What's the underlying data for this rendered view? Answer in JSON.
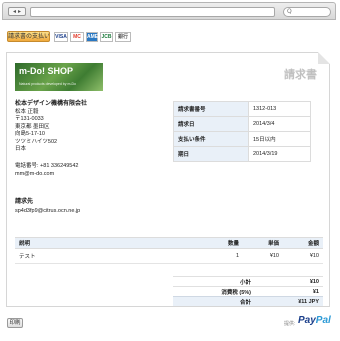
{
  "browser": {
    "nav_glyph": "◂ ▸",
    "search_glyph": "Q"
  },
  "payment": {
    "pay_button_label": "請求書の支払い",
    "cards": [
      {
        "name": "VISA",
        "bg": "#ffffff",
        "fg": "#1a3e8a",
        "w": 14
      },
      {
        "name": "MC",
        "bg": "#ffffff",
        "fg": "#e23a2a",
        "w": 14
      },
      {
        "name": "AMEX",
        "bg": "#2a78c2",
        "fg": "#ffffff",
        "w": 12
      },
      {
        "name": "JCB",
        "bg": "#ffffff",
        "fg": "#1a7a3a",
        "w": 13
      },
      {
        "name": "銀行",
        "bg": "#ffffff",
        "fg": "#555555",
        "w": 16
      }
    ]
  },
  "invoice": {
    "title": "請求書",
    "logo": {
      "main": "m-Do! SHOP",
      "sub": "Natural products developed by m-Do"
    },
    "company": {
      "name": "松本デザイン機構有限会社",
      "lines": [
        "松本 正毅",
        "〒131-0033",
        "東京都 墨田区",
        "向島5-17-10",
        "ツツミハイツ502",
        "日本"
      ]
    },
    "contact": {
      "phone": "電話番号: +81 336249542",
      "email": "mm@m-do.com"
    },
    "bill_to": {
      "heading": "請求先",
      "email": "sp4d3fp9@citrus.ocn.ne.jp"
    },
    "meta": [
      {
        "key": "請求書番号",
        "value": "1312-013"
      },
      {
        "key": "請求日",
        "value": "2014/3/4"
      },
      {
        "key": "支払い条件",
        "value": "15日以内"
      },
      {
        "key": "期日",
        "value": "2014/3/19"
      }
    ],
    "items": {
      "headers": {
        "desc": "説明",
        "qty": "数量",
        "price": "単価",
        "amount": "金額"
      },
      "rows": [
        {
          "desc": "テスト",
          "qty": "1",
          "price": "¥10",
          "amount": "¥10"
        }
      ]
    },
    "totals": [
      {
        "label": "小計",
        "value": "¥10"
      },
      {
        "label": "消費税 (5%)",
        "value": "¥1"
      },
      {
        "label": "合計",
        "value": "¥11 JPY"
      }
    ]
  },
  "footer": {
    "print_label": "印刷",
    "powered_by": "提供:",
    "paypal_a": "Pay",
    "paypal_b": "Pal"
  }
}
